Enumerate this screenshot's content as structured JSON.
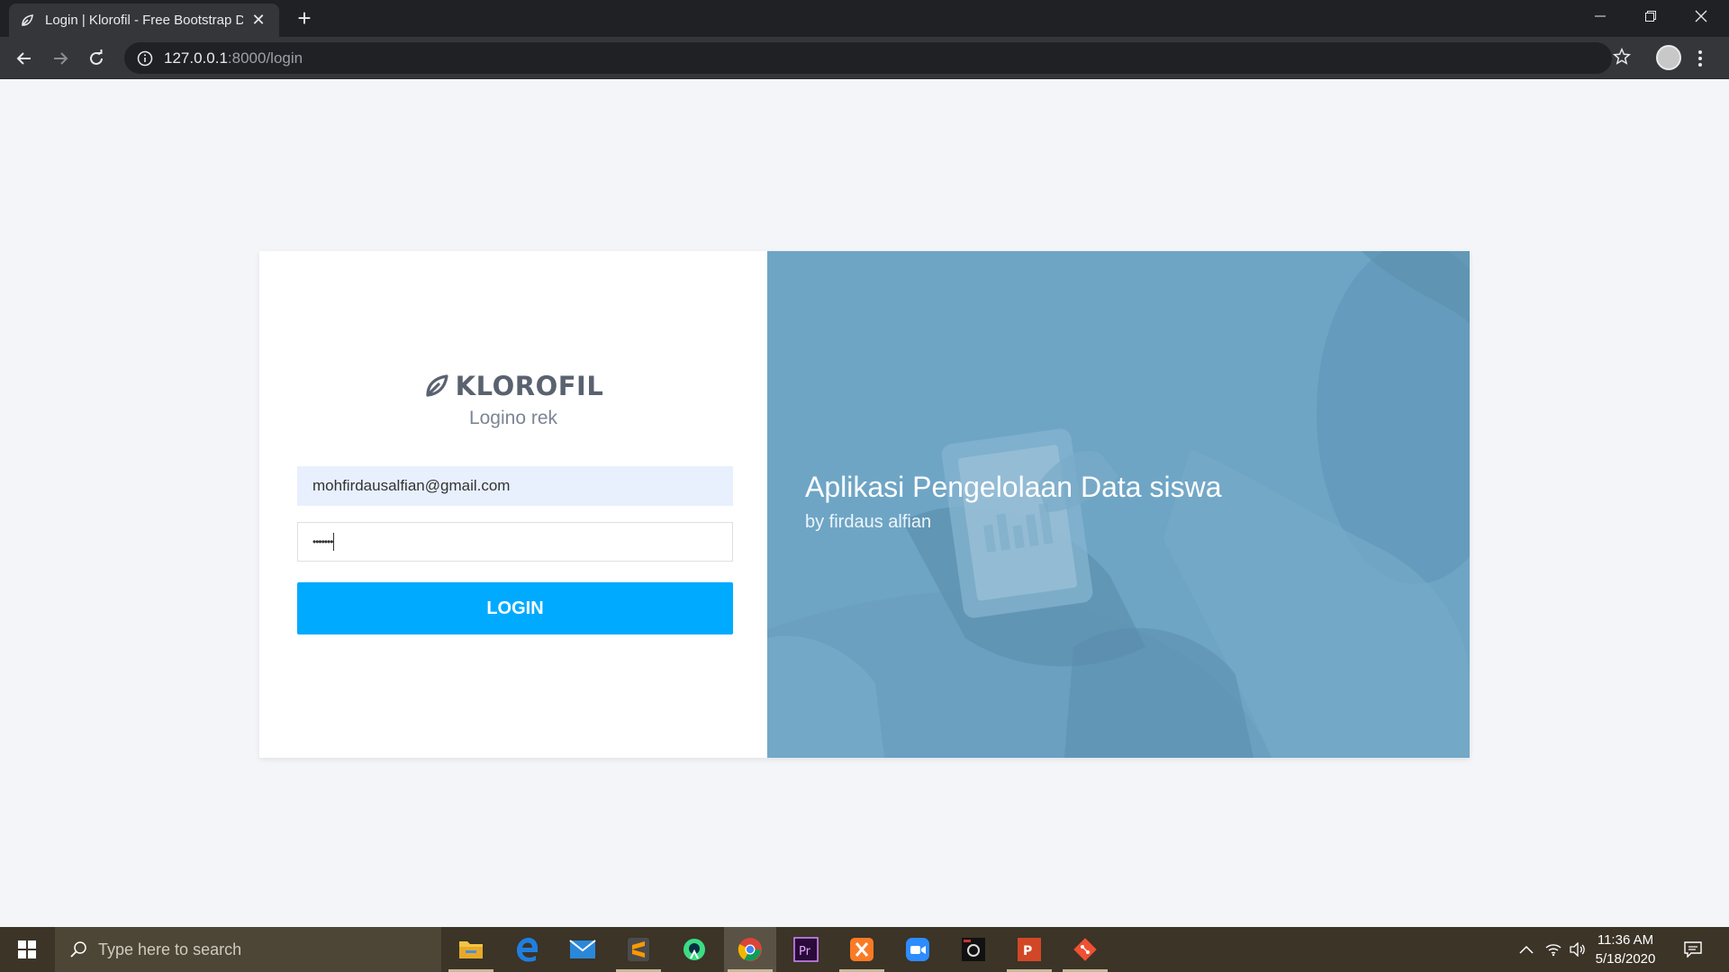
{
  "browser": {
    "tab_title": "Login | Klorofil - Free Bootstrap D",
    "tab_close": "✕",
    "new_tab": "+",
    "url_host": "127.0.0.1",
    "url_path": ":8000/login"
  },
  "login": {
    "logo_text": "KLOROFIL",
    "lead": "Logino rek",
    "email_value": "mohfirdausalfian@gmail.com",
    "password_value": "•••••••",
    "button_label": "LOGIN"
  },
  "overlay": {
    "heading": "Aplikasi Pengelolaan Data siswa",
    "subheading": "by firdaus alfian"
  },
  "taskbar": {
    "search_placeholder": "Type here to search",
    "time": "11:36 AM",
    "date": "5/18/2020",
    "apps": [
      "file-explorer",
      "edge",
      "mail",
      "sublime-text",
      "android-studio",
      "chrome",
      "premiere-pro",
      "xampp",
      "zoom",
      "unknown-app",
      "powerpoint",
      "git"
    ]
  },
  "colors": {
    "accent": "#00aaff",
    "overlay": "#6fa6c6",
    "taskbar": "#3b3427"
  }
}
